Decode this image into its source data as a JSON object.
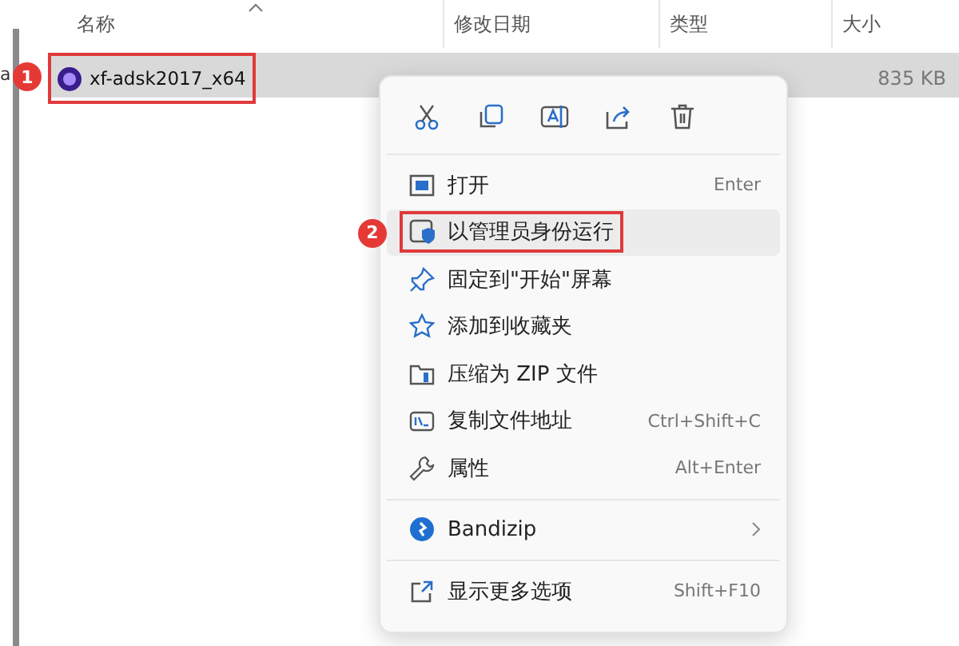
{
  "sidebar": {
    "text": "a"
  },
  "columns": [
    {
      "label": "名称",
      "sorted": true
    },
    {
      "label": "修改日期",
      "sorted": false
    },
    {
      "label": "类型",
      "sorted": false
    },
    {
      "label": "大小",
      "sorted": false
    }
  ],
  "files": [
    {
      "name": "xf-adsk2017_x64",
      "size": "835 KB",
      "selected": true,
      "callout": "1"
    }
  ],
  "menu": {
    "groups": [
      [
        {
          "label": "打开",
          "shortcut": "Enter",
          "selected": false
        },
        {
          "label": "以管理员身份运行",
          "selected": true,
          "callout": "2"
        },
        {
          "label": "固定到\"开始\"屏幕",
          "selected": false
        },
        {
          "label": "添加到收藏夹",
          "selected": false
        },
        {
          "label": "压缩为 ZIP 文件",
          "selected": false
        },
        {
          "label": "复制文件地址",
          "shortcut": "Ctrl+Shift+C",
          "selected": false
        },
        {
          "label": "属性",
          "shortcut": "Alt+Enter",
          "selected": false
        }
      ],
      [
        {
          "label": "Bandizip",
          "submenu": true,
          "selected": false
        }
      ],
      [
        {
          "label": "显示更多选项",
          "shortcut": "Shift+F10",
          "selected": false
        }
      ]
    ]
  }
}
